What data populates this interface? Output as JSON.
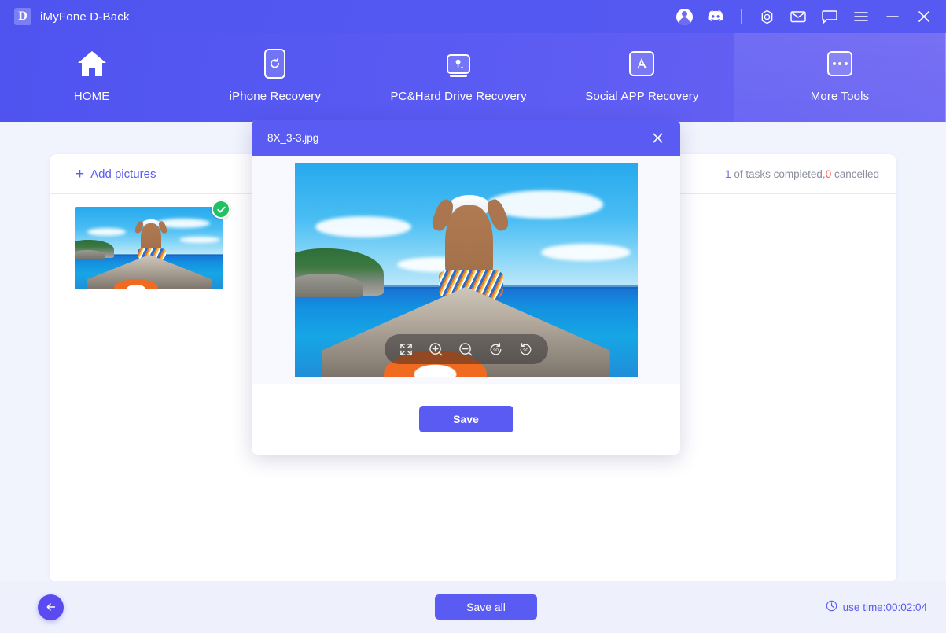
{
  "titlebar": {
    "logo_letter": "D",
    "app_name": "iMyFone D-Back",
    "icons": [
      {
        "name": "account-avatar-icon"
      },
      {
        "name": "discord-icon"
      },
      {
        "name": "divider"
      },
      {
        "name": "target-ring-icon"
      },
      {
        "name": "mail-icon"
      },
      {
        "name": "feedback-chat-icon"
      },
      {
        "name": "hamburger-menu-icon"
      },
      {
        "name": "minimize-icon"
      },
      {
        "name": "close-icon"
      }
    ]
  },
  "nav": {
    "items": [
      {
        "label": "HOME",
        "icon": "home-icon"
      },
      {
        "label": "iPhone Recovery",
        "icon": "phone-refresh-icon"
      },
      {
        "label": "PC&Hard Drive Recovery",
        "icon": "monitor-key-icon"
      },
      {
        "label": "Social APP Recovery",
        "icon": "app-store-icon"
      }
    ],
    "more": {
      "label": "More Tools",
      "icon": "ellipsis-square-icon"
    }
  },
  "card": {
    "add_pictures_label": "Add pictures",
    "plus_glyph": "+",
    "status": {
      "completed_count": "1",
      "completed_text": " of tasks completed,",
      "cancelled_count": "0",
      "cancelled_text": " cancelled"
    },
    "thumbnails": [
      {
        "name": "8X_3-3.jpg",
        "selected": true
      }
    ]
  },
  "modal": {
    "title": "8X_3-3.jpg",
    "close_label": "✕",
    "save_label": "Save",
    "toolbar": [
      {
        "name": "fit-screen-icon",
        "label": "Fit to screen"
      },
      {
        "name": "zoom-in-icon",
        "label": "Zoom in"
      },
      {
        "name": "zoom-out-icon",
        "label": "Zoom out"
      },
      {
        "name": "rotate-left-90-icon",
        "label": "90"
      },
      {
        "name": "rotate-right-90-icon",
        "label": "90"
      }
    ]
  },
  "footer": {
    "back_label": "←",
    "save_all_label": "Save all",
    "use_time_label": "use time:00:02:04"
  },
  "colors": {
    "brand_purple": "#5a5bf2",
    "header_gradient_start": "#4f53ef",
    "header_gradient_end": "#6a62f2",
    "page_background": "#f1f4fd",
    "footer_background": "#eef1fc",
    "success_green": "#21c063",
    "cancel_red": "#ef5b54",
    "muted_text": "#8b8f9e"
  }
}
